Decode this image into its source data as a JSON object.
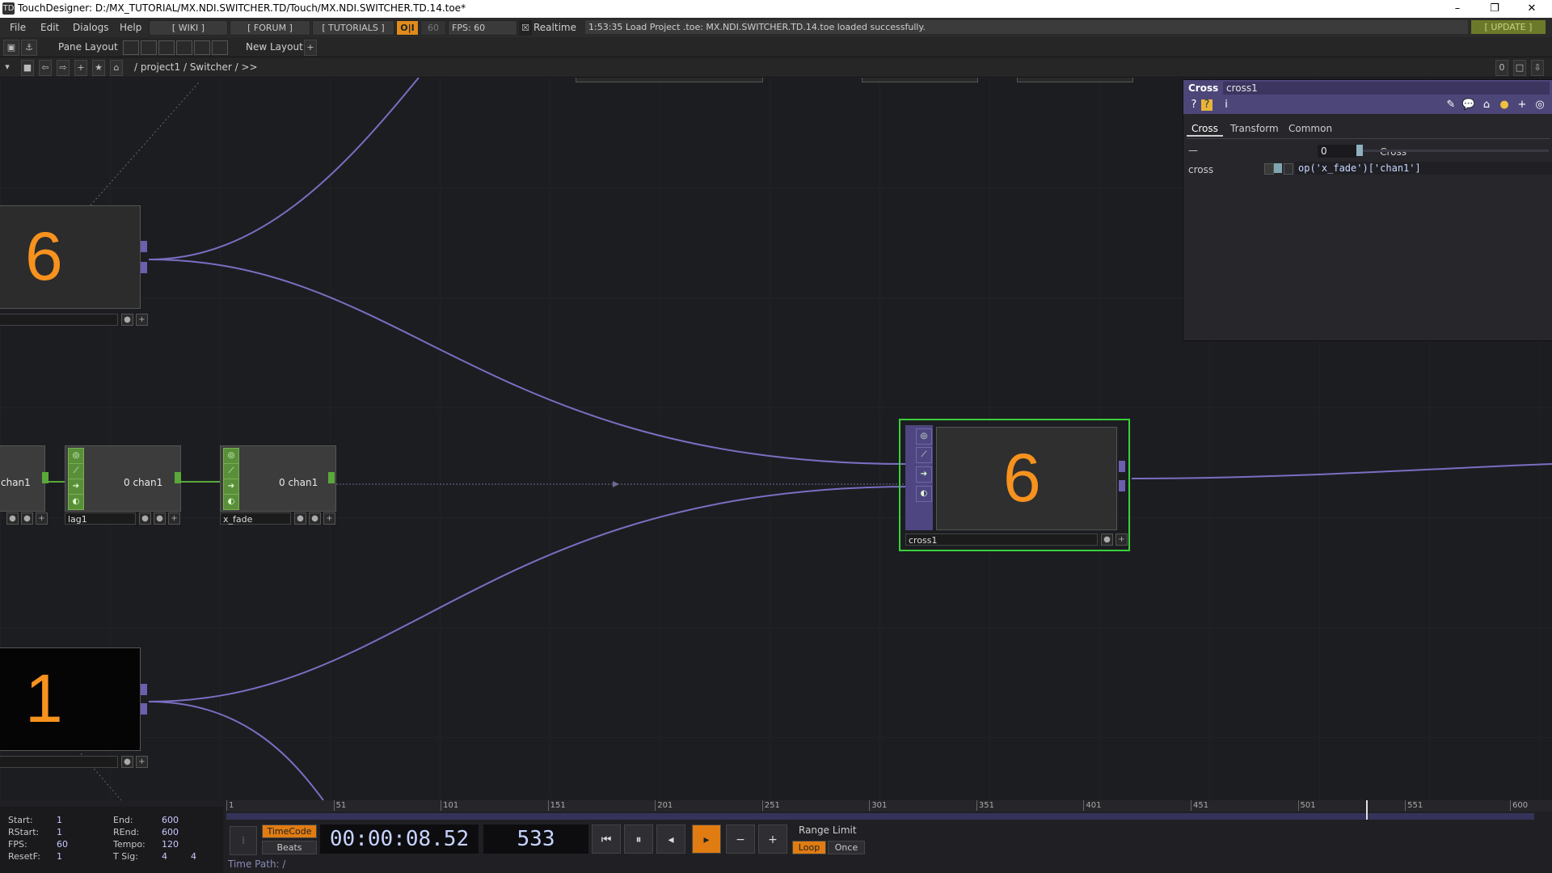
{
  "window": {
    "title": "TouchDesigner: D:/MX_TUTORIAL/MX.NDI.SWITCHER.TD/Touch/MX.NDI.SWITCHER.TD.14.toe*",
    "minimize": "–",
    "restore": "❐",
    "close": "✕"
  },
  "menu": {
    "items": [
      "File",
      "Edit",
      "Dialogs",
      "Help"
    ],
    "wiki": "[ WIKI ]",
    "forum": "[ FORUM ]",
    "tutorials": "[ TUTORIALS ]",
    "oi": "O|I",
    "fps_num": "60",
    "fps_label": "FPS: 60",
    "realtime": "Realtime",
    "status_message": "1:53:35 Load Project .toe: MX.NDI.SWITCHER.TD.14.toe loaded successfully.",
    "update": "[ UPDATE ]"
  },
  "toolbar": {
    "pane_layout": "Pane Layout",
    "new_layout": "New Layout",
    "add": "+",
    "path": "/ project1 / Switcher / >>",
    "pane_index": "0"
  },
  "network": {
    "top_node_value": "6",
    "bottom_node_value": "1",
    "cross_node_value": "6",
    "cross_node_name": "cross1",
    "left_chop_text": "chan1",
    "lag_text": "0 chan1",
    "lag_name": "lag1",
    "xfade_text": "0 chan1",
    "xfade_name": "x_fade"
  },
  "parameters": {
    "op_type": "Cross",
    "op_name": "cross1",
    "tabs": [
      "Cross",
      "Transform",
      "Common"
    ],
    "active_tab": "Cross",
    "cross_label": "Cross",
    "cross_value": "0",
    "cross_slider": 0.0,
    "expr_label": "cross",
    "expr_value": "op('x_fade')['chan1']",
    "collapse": "—"
  },
  "timeline": {
    "ticks": [
      "1",
      "51",
      "101",
      "151",
      "201",
      "251",
      "301",
      "351",
      "401",
      "451",
      "501",
      "551",
      "600"
    ],
    "start_label": "Start:",
    "start": "1",
    "end_label": "End:",
    "end": "600",
    "rstart_label": "RStart:",
    "rstart": "1",
    "rend_label": "REnd:",
    "rend": "600",
    "fps_label": "FPS:",
    "fps": "60",
    "tempo_label": "Tempo:",
    "tempo": "120",
    "resetf_label": "ResetF:",
    "resetf": "1",
    "tsig_label": "T Sig:",
    "tsig_a": "4",
    "tsig_b": "4",
    "timecode_btn": "TimeCode",
    "beats_btn": "Beats",
    "timecode": "00:00:08.52",
    "frame": "533",
    "range_limit": "Range Limit",
    "loop": "Loop",
    "once": "Once",
    "time_path_label": "Time Path: /",
    "playhead_frame": 533,
    "total_frames": 600
  },
  "colors": {
    "accent_orange": "#f7921e",
    "selection_green": "#3ad13a",
    "wire_purple": "#7a6ec2",
    "header_purple": "#4d4679"
  }
}
